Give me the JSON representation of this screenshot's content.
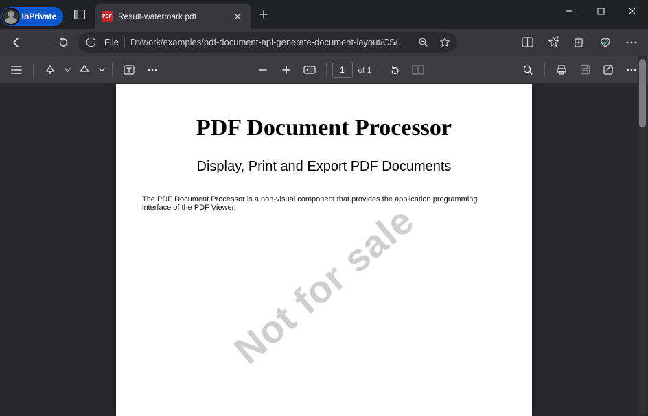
{
  "titlebar": {
    "inprivate_label": "InPrivate",
    "tab_title": "Result-watermark.pdf",
    "pdf_badge": "PDF"
  },
  "address": {
    "scheme_label": "File",
    "path": "D:/work/examples/pdf-document-api-generate-document-layout/CS/..."
  },
  "pdf_toolbar": {
    "page_input": 1,
    "page_total_label": "of 1"
  },
  "document": {
    "heading": "PDF Document Processor",
    "subheading": "Display, Print and Export PDF Documents",
    "body": "The PDF Document Processor is a non-visual component that provides the application programming interface of the PDF Viewer.",
    "watermark": "Not for sale"
  }
}
